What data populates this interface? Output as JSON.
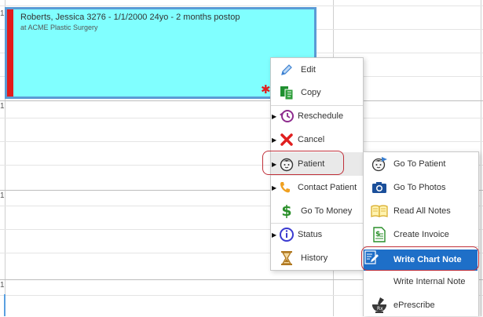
{
  "hour_label": "1",
  "appointment": {
    "title": "Roberts, Jessica 3276 - 1/1/2000 24yo - 2 months postop",
    "location": "at ACME Plastic Surgery",
    "flag_symbol": "✱",
    "colors": {
      "background": "#80ffff",
      "border": "#5b9bd5",
      "status_bar": "#e21b1b"
    }
  },
  "context_menu": {
    "items": [
      {
        "label": "Edit",
        "icon": "pencil-icon",
        "has_submenu": false
      },
      {
        "label": "Copy",
        "icon": "copy-icon",
        "has_submenu": false
      },
      {
        "label": "Reschedule",
        "icon": "reschedule-icon",
        "has_submenu": true
      },
      {
        "label": "Cancel",
        "icon": "cancel-x-icon",
        "has_submenu": true
      },
      {
        "label": "Patient",
        "icon": "patient-face-icon",
        "has_submenu": true
      },
      {
        "label": "Contact Patient",
        "icon": "phone-icon",
        "has_submenu": true
      },
      {
        "label": "Go To Money",
        "icon": "dollar-icon",
        "has_submenu": false
      },
      {
        "label": "Status",
        "icon": "info-icon",
        "has_submenu": true
      },
      {
        "label": "History",
        "icon": "hourglass-icon",
        "has_submenu": false
      }
    ]
  },
  "patient_submenu": {
    "items": [
      {
        "label": "Go To Patient",
        "icon": "patient-go-icon"
      },
      {
        "label": "Go To Photos",
        "icon": "camera-icon"
      },
      {
        "label": "Read All Notes",
        "icon": "book-icon"
      },
      {
        "label": "Create Invoice",
        "icon": "invoice-icon"
      },
      {
        "label": "Write Chart Note",
        "icon": "chart-note-icon",
        "highlighted": true
      },
      {
        "label": "Write Internal Note",
        "icon": ""
      },
      {
        "label": "ePrescribe",
        "icon": "mortar-pestle-icon"
      }
    ]
  },
  "colors": {
    "highlight": "#1e6fc8",
    "annotation_oval": "#c0303a"
  }
}
